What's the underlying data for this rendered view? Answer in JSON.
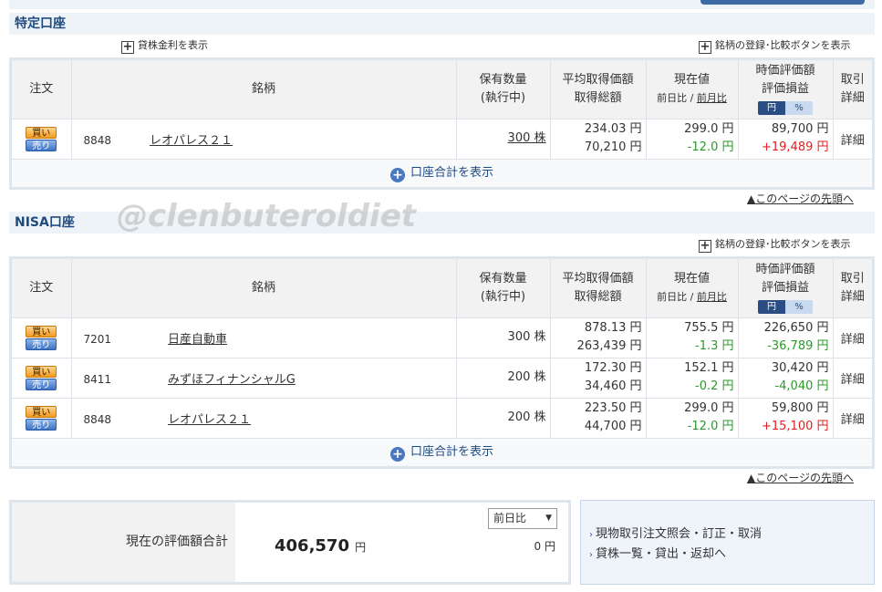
{
  "sections": {
    "tokutei": {
      "title": "特定口座",
      "lending_link": "貸株金利を表示",
      "register_link": "銘柄の登録･比較ボタンを表示",
      "summary_link": "口座合計を表示",
      "page_top_link": "▲このページの先頭へ",
      "rows": [
        {
          "buy": "買い",
          "sell": "売り",
          "code": "8848",
          "name": "レオパレス２１",
          "qty": "300 株",
          "avg_price": "234.03 円",
          "total_cost": "70,210 円",
          "price": "299.0 円",
          "change": "-12.0 円",
          "market_value": "89,700 円",
          "pl": "+19,489 円",
          "detail": "詳細"
        }
      ]
    },
    "nisa": {
      "title": "NISA口座",
      "register_link": "銘柄の登録･比較ボタンを表示",
      "summary_link": "口座合計を表示",
      "page_top_link": "▲このページの先頭へ",
      "rows": [
        {
          "buy": "買い",
          "sell": "売り",
          "code": "7201",
          "name": "日産自動車",
          "qty": "300 株",
          "avg_price": "878.13 円",
          "total_cost": "263,439 円",
          "price": "755.5 円",
          "change": "-1.3 円",
          "market_value": "226,650 円",
          "pl": "-36,789 円",
          "detail": "詳細"
        },
        {
          "buy": "買い",
          "sell": "売り",
          "code": "8411",
          "name": "みずほフィナンシャルG",
          "qty": "200 株",
          "avg_price": "172.30 円",
          "total_cost": "34,460 円",
          "price": "152.1 円",
          "change": "-0.2 円",
          "market_value": "30,420 円",
          "pl": "-4,040 円",
          "detail": "詳細"
        },
        {
          "buy": "買い",
          "sell": "売り",
          "code": "8848",
          "name": "レオパレス２１",
          "qty": "200 株",
          "avg_price": "223.50 円",
          "total_cost": "44,700 円",
          "price": "299.0 円",
          "change": "-12.0 円",
          "market_value": "59,800 円",
          "pl": "+15,100 円",
          "detail": "詳細"
        }
      ]
    }
  },
  "headers": {
    "order": "注文",
    "brand": "銘柄",
    "qty_1": "保有数量",
    "qty_2": "(執行中)",
    "avg_1": "平均取得価額",
    "avg_2": "取得総額",
    "price_1": "現在値",
    "price_2a": "前日比",
    "price_sep": " / ",
    "price_2b": "前月比",
    "mv_1": "時価評価額",
    "mv_2": "評価損益",
    "toggle_yen": "円",
    "toggle_pct": "%",
    "trade_1": "取引",
    "trade_2": "詳細"
  },
  "watermark": "@clenbuteroldiet",
  "evaluation": {
    "label": "現在の評価額合計",
    "value": "406,570",
    "unit": "円",
    "compare_select": "前日比",
    "compare_value": "0 円"
  },
  "links": {
    "item1": "現物取引注文照会・訂正・取消",
    "item2": "貸株一覧・貸出・返却へ"
  },
  "colors": {
    "header_blue": "#1f4b82",
    "negative": "#2a9a2a",
    "positive": "#e02020",
    "buy_orange": "#f39a1f",
    "sell_blue": "#3d72c4"
  }
}
